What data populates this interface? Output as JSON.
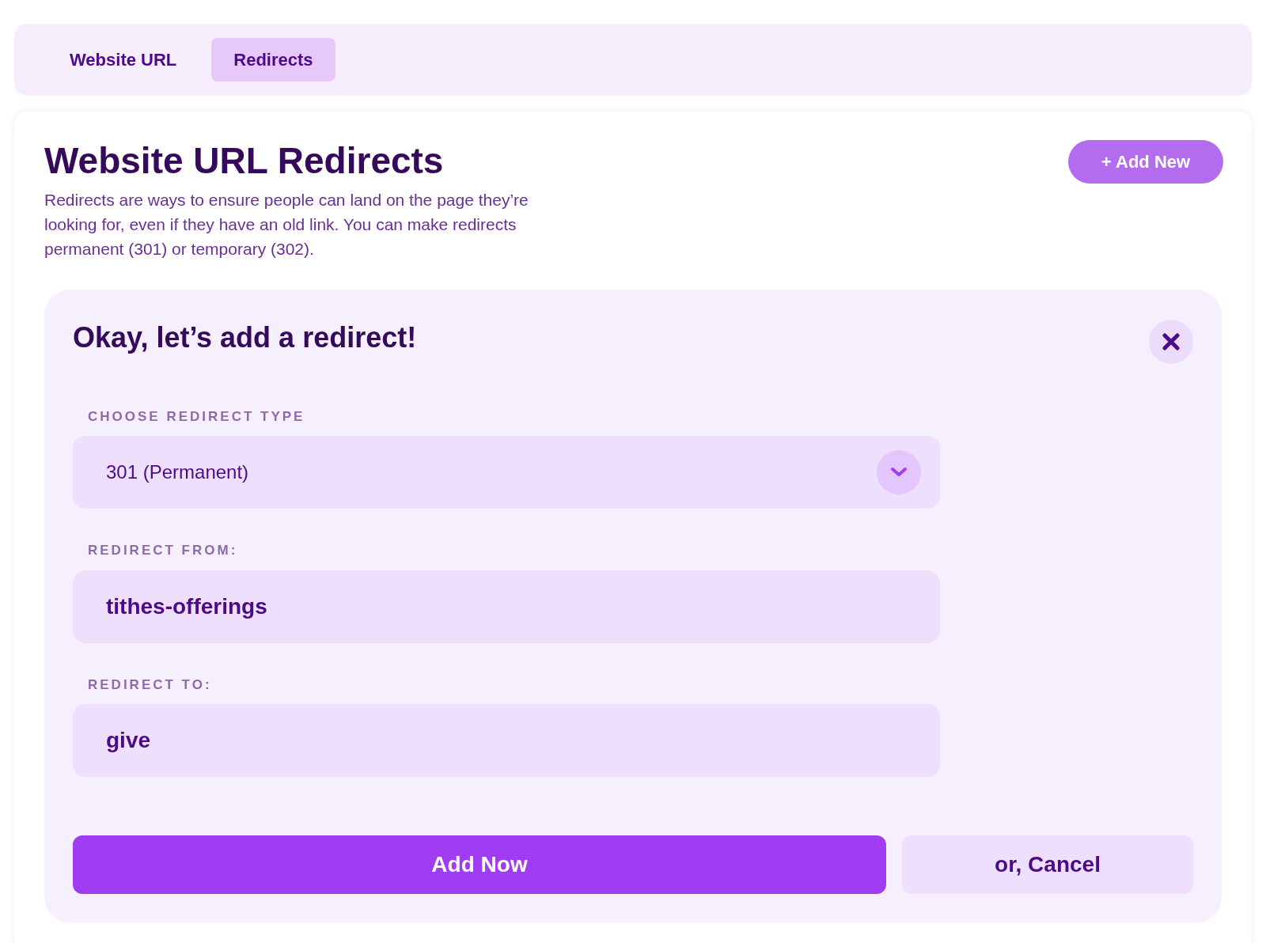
{
  "tabs": [
    {
      "label": "Website URL",
      "selected": false
    },
    {
      "label": "Redirects",
      "selected": true
    }
  ],
  "header": {
    "title": "Website URL Redirects",
    "description": "Redirects are ways to ensure people can land on the page they’re looking for, even if they have an old link. You can make redirects permanent (301) or temporary (302).",
    "add_button": "+ Add New"
  },
  "form": {
    "title": "Okay, let’s add a redirect!",
    "fields": [
      {
        "kind": "select",
        "label": "CHOOSE REDIRECT TYPE",
        "value": "301 (Permanent)"
      },
      {
        "kind": "text",
        "label": "REDIRECT FROM:",
        "value": "tithes-offerings"
      },
      {
        "kind": "text",
        "label": "REDIRECT TO:",
        "value": "give"
      }
    ],
    "submit": "Add Now",
    "cancel": "or, Cancel"
  }
}
